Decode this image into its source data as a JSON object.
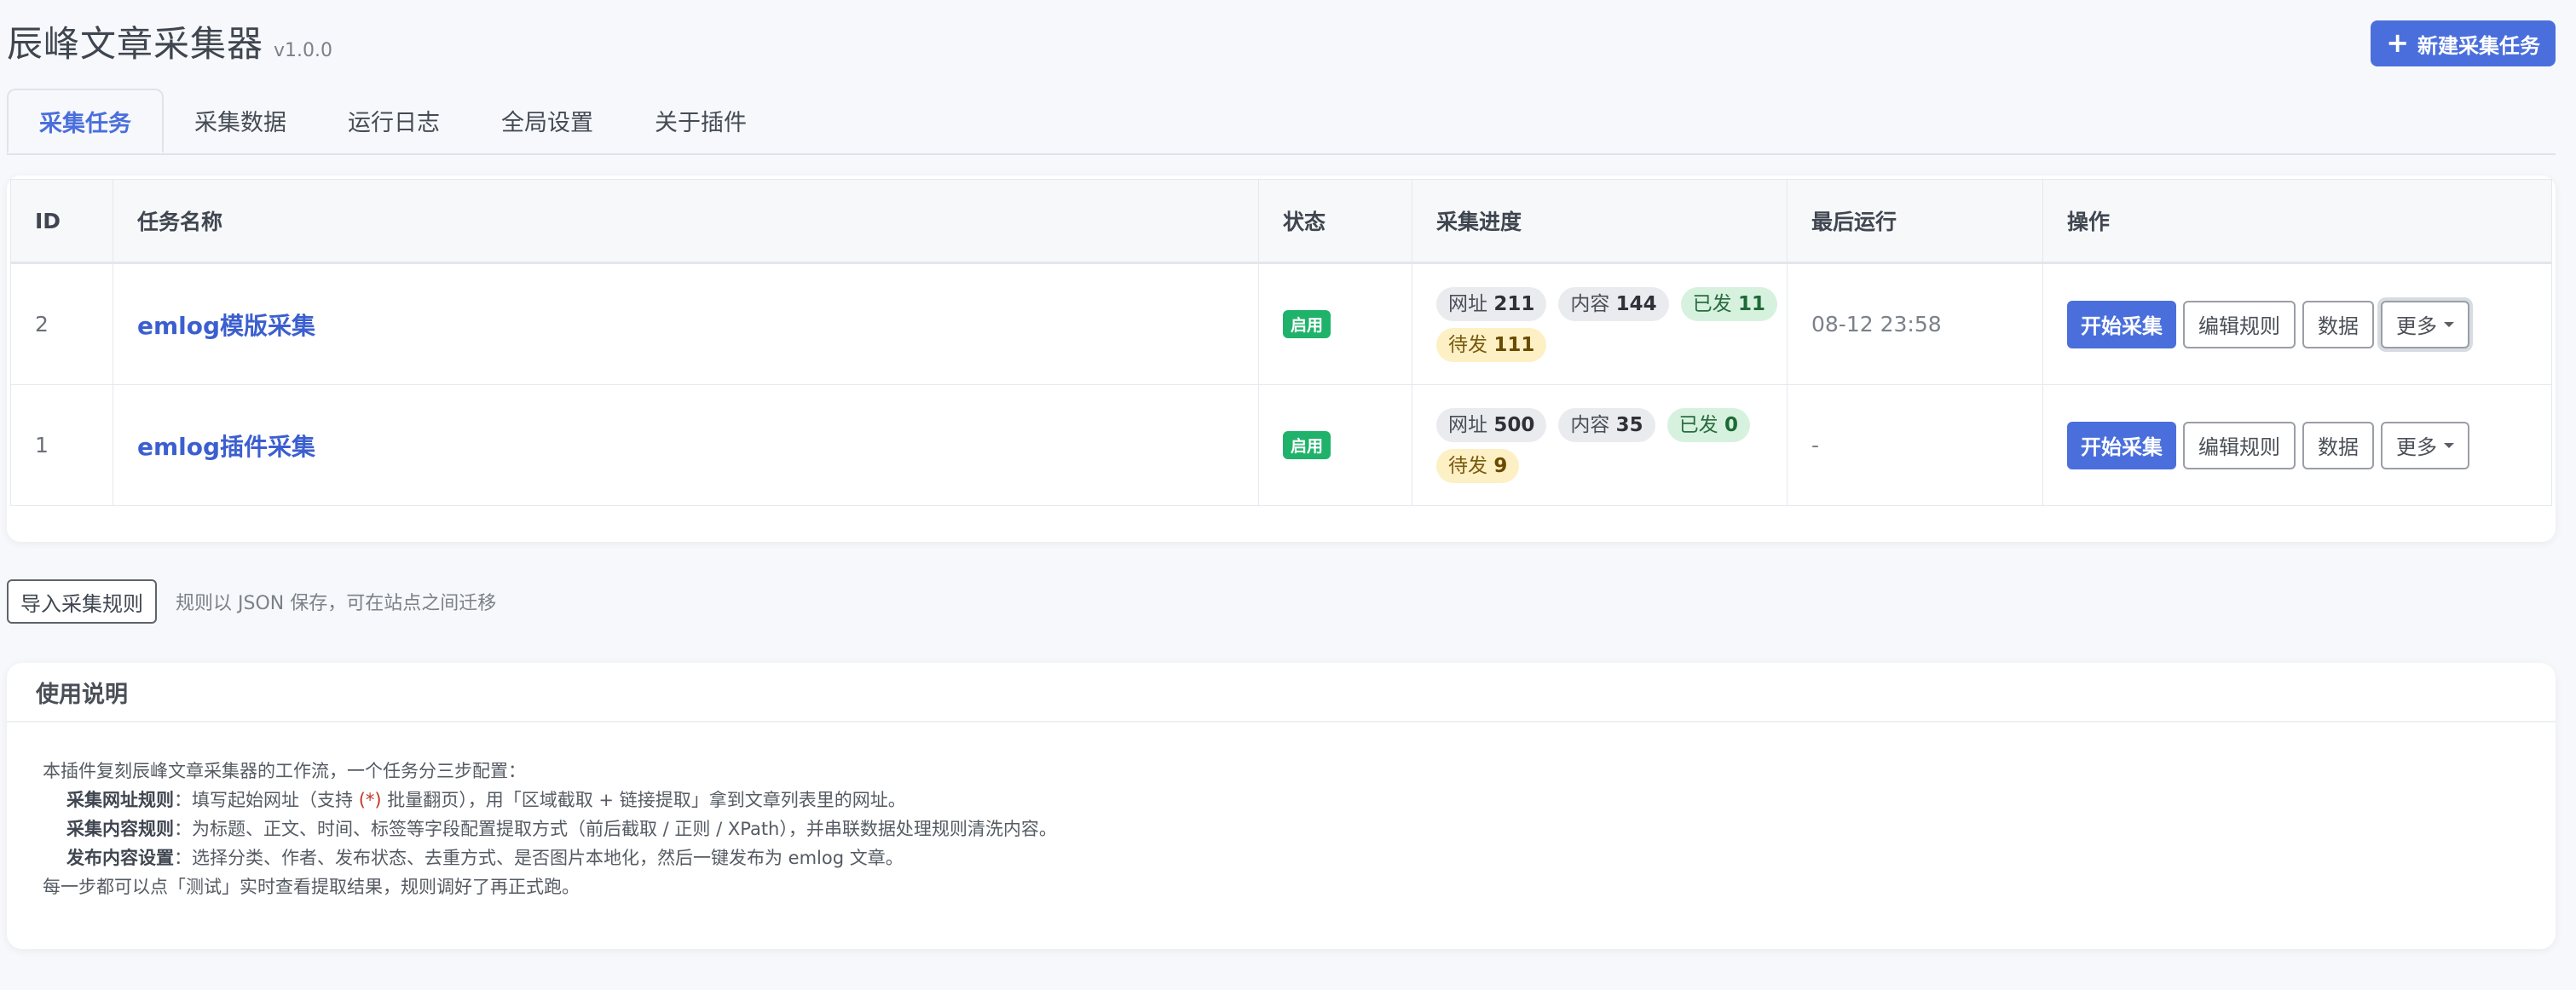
{
  "header": {
    "title": "辰峰文章采集器",
    "version": "v1.0.0",
    "new_task_label": "新建采集任务"
  },
  "tabs": [
    {
      "label": "采集任务",
      "active": true
    },
    {
      "label": "采集数据",
      "active": false
    },
    {
      "label": "运行日志",
      "active": false
    },
    {
      "label": "全局设置",
      "active": false
    },
    {
      "label": "关于插件",
      "active": false
    }
  ],
  "table": {
    "columns": [
      "ID",
      "任务名称",
      "状态",
      "采集进度",
      "最后运行",
      "操作"
    ],
    "rows": [
      {
        "id": "2",
        "name": "emlog模版采集",
        "status": "启用",
        "progress": {
          "url_label": "网址",
          "url": "211",
          "content_label": "内容",
          "content": "144",
          "published_label": "已发",
          "published": "11",
          "pending_label": "待发",
          "pending": "111"
        },
        "last_run": "08-12 23:58",
        "actions": {
          "start": "开始采集",
          "edit": "编辑规则",
          "data": "数据",
          "more": "更多"
        }
      },
      {
        "id": "1",
        "name": "emlog插件采集",
        "status": "启用",
        "progress": {
          "url_label": "网址",
          "url": "500",
          "content_label": "内容",
          "content": "35",
          "published_label": "已发",
          "published": "0",
          "pending_label": "待发",
          "pending": "9"
        },
        "last_run": "-",
        "actions": {
          "start": "开始采集",
          "edit": "编辑规则",
          "data": "数据",
          "more": "更多"
        }
      }
    ]
  },
  "import": {
    "button_label": "导入采集规则",
    "hint": "规则以 JSON 保存，可在站点之间迁移"
  },
  "help": {
    "title": "使用说明",
    "intro": "本插件复刻辰峰文章采集器的工作流，一个任务分三步配置：",
    "steps": [
      {
        "label": "采集网址规则",
        "text_before": "：填写起始网址（支持 ",
        "code": "(*)",
        "text_after": " 批量翻页），用「区域截取 + 链接提取」拿到文章列表里的网址。"
      },
      {
        "label": "采集内容规则",
        "text_before": "：为标题、正文、时间、标签等字段配置提取方式（前后截取 / 正则 / XPath），并串联数据处理规则清洗内容。",
        "code": "",
        "text_after": ""
      },
      {
        "label": "发布内容设置",
        "text_before": "：选择分类、作者、发布状态、去重方式、是否图片本地化，然后一键发布为 emlog 文章。",
        "code": "",
        "text_after": ""
      }
    ],
    "outro": "每一步都可以点「测试」实时查看提取结果，规则调好了再正式跑。"
  },
  "colors": {
    "accent": "#4a6fdc",
    "status_enabled": "#1fb26b",
    "published_pill": "#d6f2df",
    "pending_pill": "#fdf0c4"
  }
}
